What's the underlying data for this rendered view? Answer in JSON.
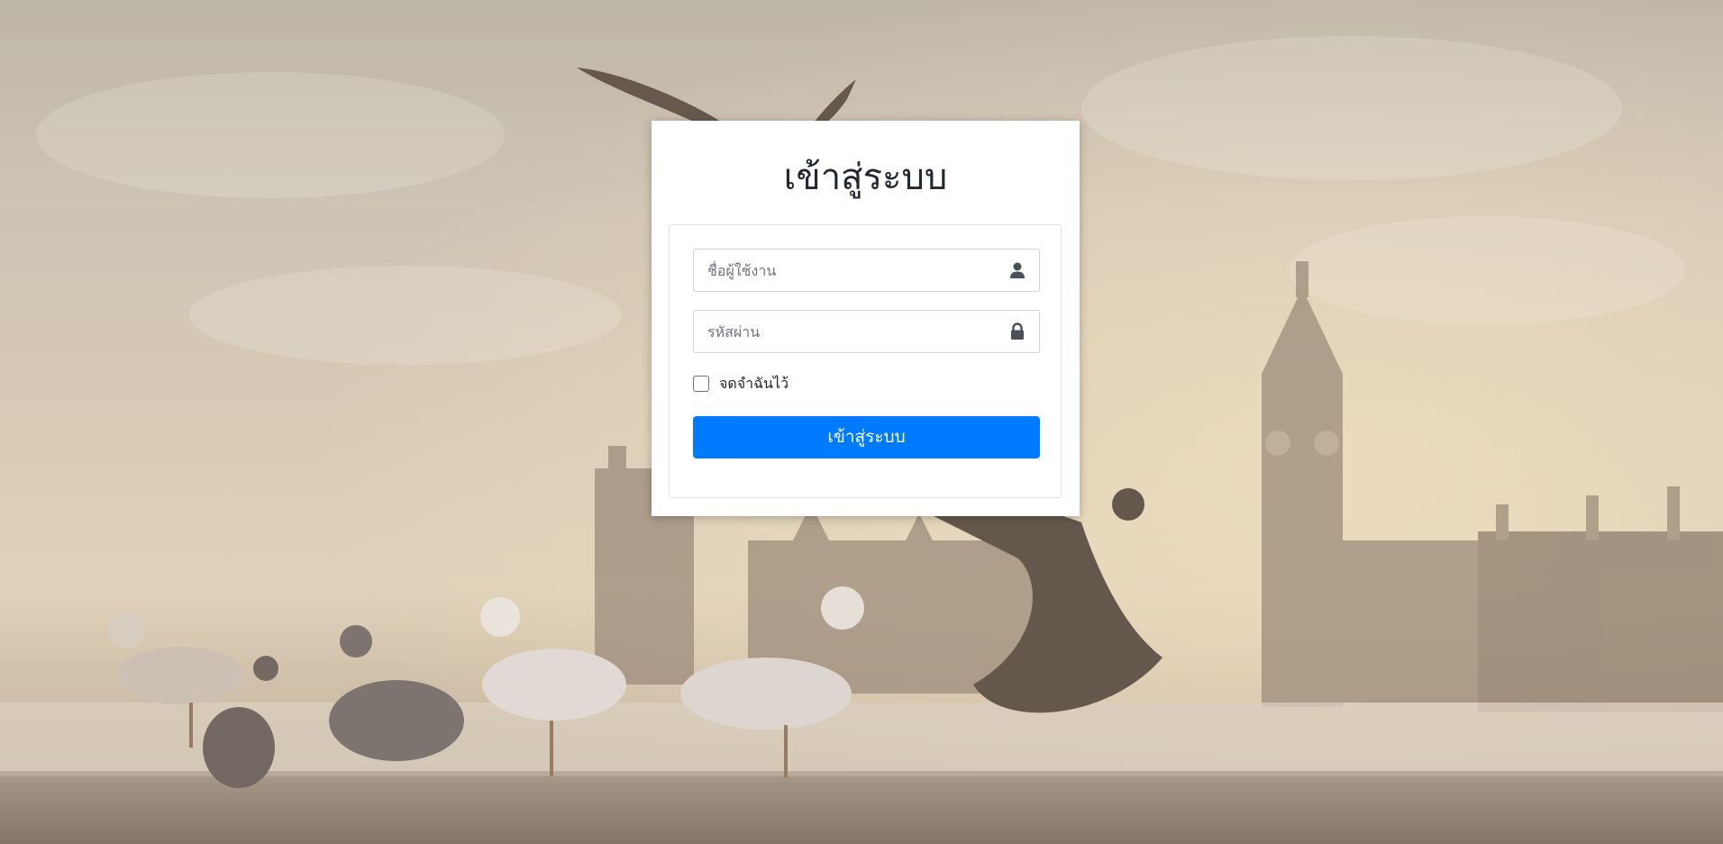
{
  "page": {
    "title": "เข้าสู่ระบบ"
  },
  "form": {
    "username": {
      "placeholder": "ชื่อผู้ใช้งาน",
      "value": "",
      "icon": "user-icon"
    },
    "password": {
      "placeholder": "รหัสผ่าน",
      "value": "",
      "icon": "lock-icon"
    },
    "remember_label": "จดจำฉันไว้",
    "remember_checked": false,
    "submit_label": "เข้าสู่ระบบ"
  },
  "colors": {
    "primary": "#007bff",
    "card_bg": "#ffffff",
    "title_text": "#222831",
    "border": "#ced4da"
  }
}
